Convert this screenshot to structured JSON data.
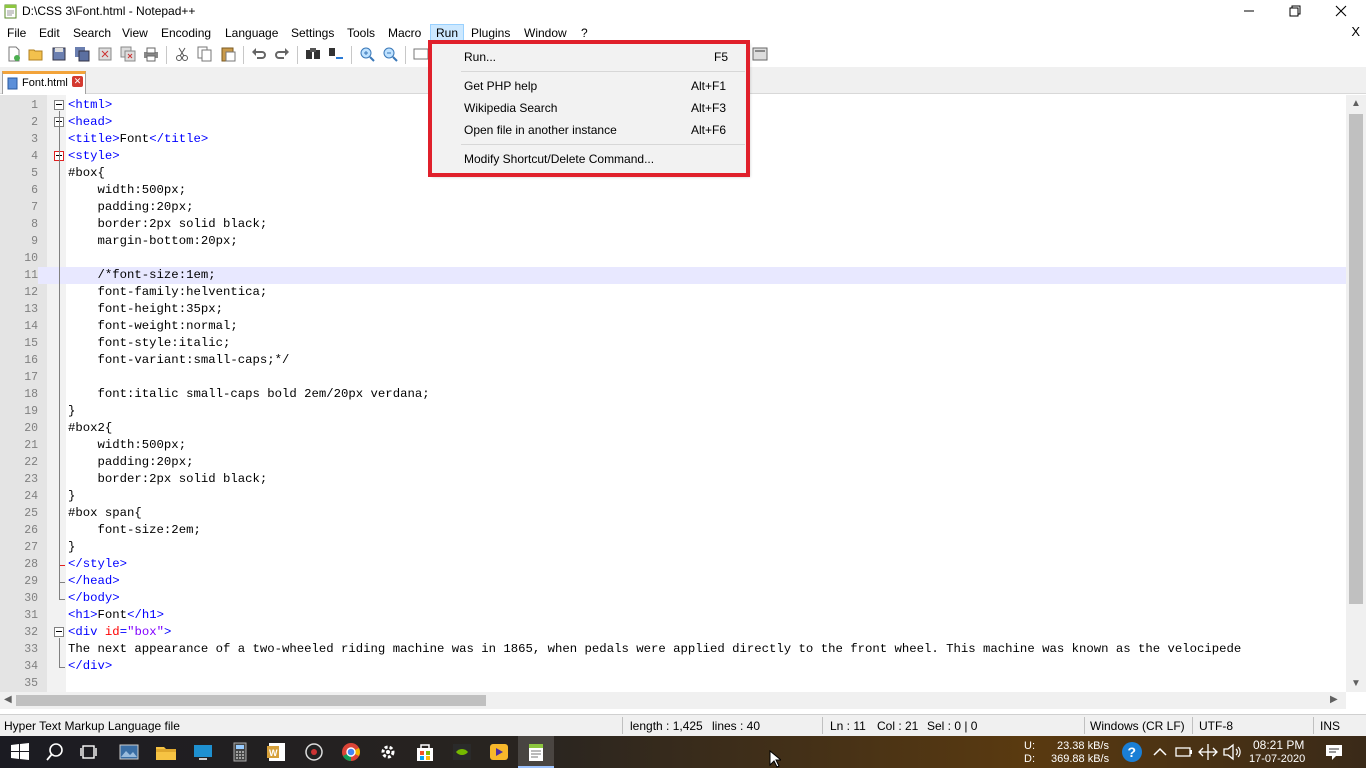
{
  "window": {
    "title": "D:\\CSS 3\\Font.html - Notepad++"
  },
  "menubar": {
    "items": [
      "File",
      "Edit",
      "Search",
      "View",
      "Encoding",
      "Language",
      "Settings",
      "Tools",
      "Macro",
      "Run",
      "Plugins",
      "Window",
      "?"
    ],
    "close_label": "X"
  },
  "tabs": [
    {
      "label": "Font.html"
    }
  ],
  "run_menu": {
    "items": [
      {
        "label": "Run...",
        "shortcut": "F5"
      },
      {
        "label": "Get PHP help",
        "shortcut": "Alt+F1"
      },
      {
        "label": "Wikipedia Search",
        "shortcut": "Alt+F3"
      },
      {
        "label": "Open file in another instance",
        "shortcut": "Alt+F6"
      },
      {
        "label": "Modify Shortcut/Delete Command...",
        "shortcut": ""
      }
    ]
  },
  "editor": {
    "current_line": 11,
    "lines": [
      "<html>",
      "<head>",
      "<title>Font</title>",
      "<style>",
      "#box{",
      "    width:500px;",
      "    padding:20px;",
      "    border:2px solid black;",
      "    margin-bottom:20px;",
      "",
      "    /*font-size:1em;",
      "    font-family:helventica;",
      "    font-height:35px;",
      "    font-weight:normal;",
      "    font-style:italic;",
      "    font-variant:small-caps;*/",
      "",
      "    font:italic small-caps bold 2em/20px verdana;",
      "}",
      "#box2{",
      "    width:500px;",
      "    padding:20px;",
      "    border:2px solid black;",
      "}",
      "#box span{",
      "    font-size:2em;",
      "}",
      "</style>",
      "</head>",
      "</body>",
      "<h1>Font</h1>",
      "<div id=\"box\">",
      "The next appearance of a two-wheeled riding machine was in 1865, when pedals were applied directly to the front wheel. This machine was known as the velocipede",
      "</div>",
      ""
    ]
  },
  "statusbar": {
    "filetype": "Hyper Text Markup Language file",
    "length": "length : 1,425",
    "lines": "lines : 40",
    "ln": "Ln : 11",
    "col": "Col : 21",
    "sel": "Sel : 0 | 0",
    "eol": "Windows (CR LF)",
    "encoding": "UTF-8",
    "mode": "INS"
  },
  "taskbar": {
    "net_up_label": "U:",
    "net_down_label": "D:",
    "net_up": "23.38 kB/s",
    "net_down": "369.88 kB/s",
    "time": "08:21 PM",
    "date": "17-07-2020"
  },
  "colors": {
    "tag": "#0000ff",
    "attr": "#ff0000",
    "value": "#8000ff",
    "highlight": "#e0202b"
  }
}
